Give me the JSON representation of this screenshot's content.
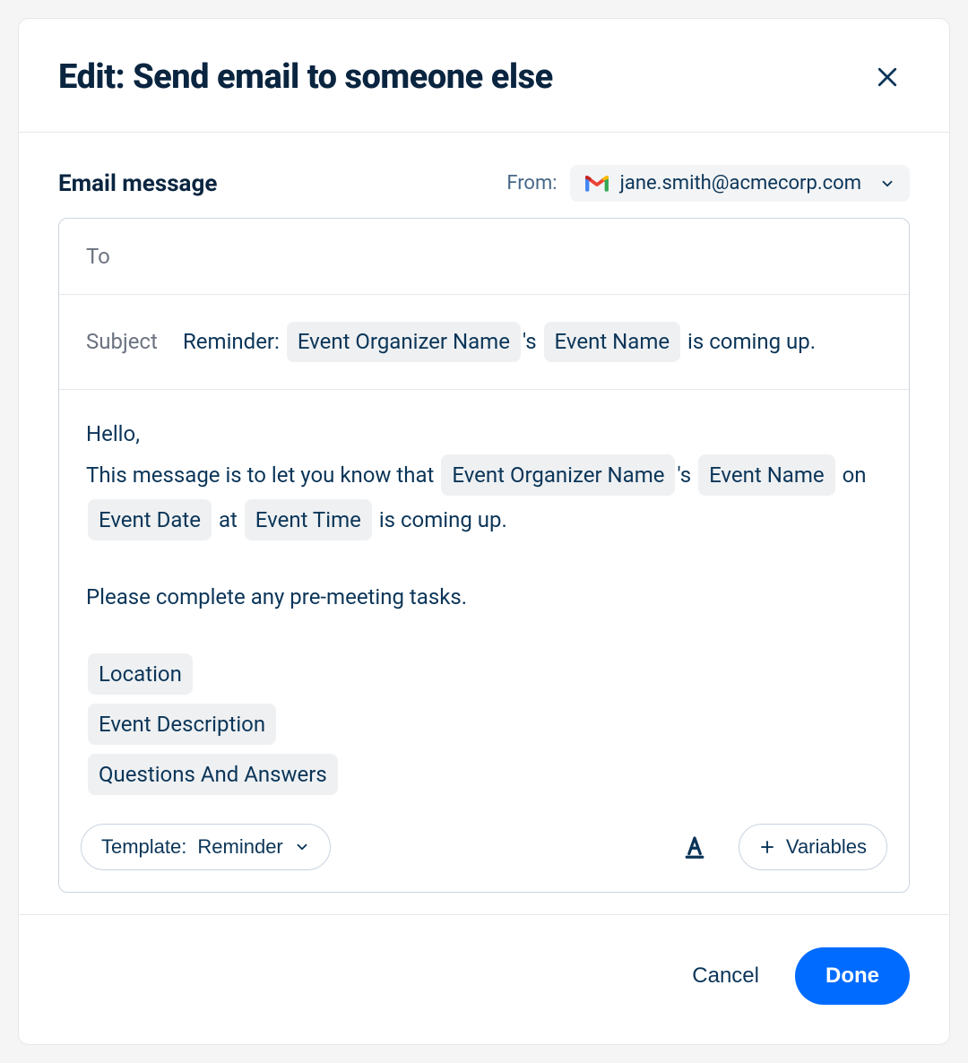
{
  "header": {
    "title": "Edit: Send email to someone else"
  },
  "section": {
    "label": "Email message",
    "from_label": "From:",
    "from_email": "jane.smith@acmecorp.com"
  },
  "fields": {
    "to_label": "To",
    "subject_label": "Subject"
  },
  "subject": {
    "seg0": "Reminder: ",
    "chip0": "Event Organizer Name",
    "seg1": "'s ",
    "chip1": "Event Name",
    "seg2": " is coming up."
  },
  "body": {
    "greeting": "Hello,",
    "line1_a": "This message is to let you know that ",
    "chip_org": "Event Organizer Name",
    "line1_b": "'s ",
    "chip_event": "Event Name",
    "line1_c": " on ",
    "chip_date": "Event Date",
    "line1_d": " at ",
    "chip_time": "Event Time",
    "line1_e": " is coming up.",
    "line2": "Please complete any pre-meeting tasks.",
    "vars": {
      "location": "Location",
      "description": "Event Description",
      "qa": "Questions And Answers"
    }
  },
  "toolbar": {
    "template_prefix": "Template: ",
    "template_name": "Reminder",
    "variables_label": "Variables"
  },
  "footer": {
    "cancel": "Cancel",
    "done": "Done"
  },
  "icons": {
    "close": "close-icon",
    "gmail": "gmail-icon",
    "chevron_down": "chevron-down-icon",
    "text_format": "text-format-icon",
    "plus": "plus-icon"
  }
}
